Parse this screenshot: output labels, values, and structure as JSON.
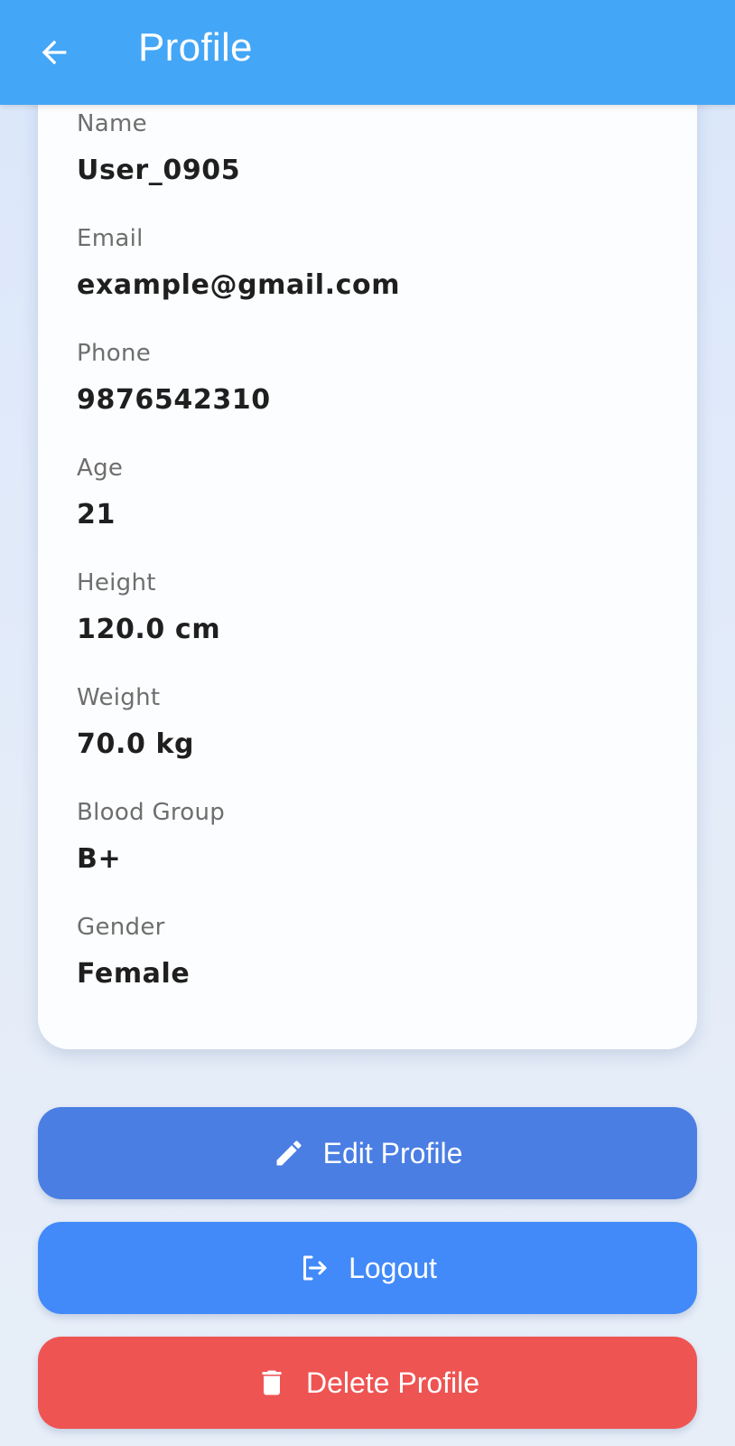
{
  "app_bar": {
    "title": "Profile",
    "color": "#44a6f6"
  },
  "profile": {
    "fields": [
      {
        "label": "Name",
        "value": "User_0905"
      },
      {
        "label": "Email",
        "value": "example@gmail.com"
      },
      {
        "label": "Phone",
        "value": "9876542310"
      },
      {
        "label": "Age",
        "value": "21"
      },
      {
        "label": "Height",
        "value": "120.0 cm"
      },
      {
        "label": "Weight",
        "value": "70.0 kg"
      },
      {
        "label": "Blood Group",
        "value": "B+"
      },
      {
        "label": "Gender",
        "value": "Female"
      }
    ]
  },
  "actions": {
    "edit_label": "Edit Profile",
    "logout_label": "Logout",
    "delete_label": "Delete Profile"
  },
  "icons": {
    "back": "arrow-left-icon",
    "edit": "pencil-icon",
    "logout": "logout-icon",
    "delete": "trash-icon"
  },
  "colors": {
    "edit": "#4a7ee3",
    "logout": "#428af9",
    "delete": "#ee5452"
  }
}
